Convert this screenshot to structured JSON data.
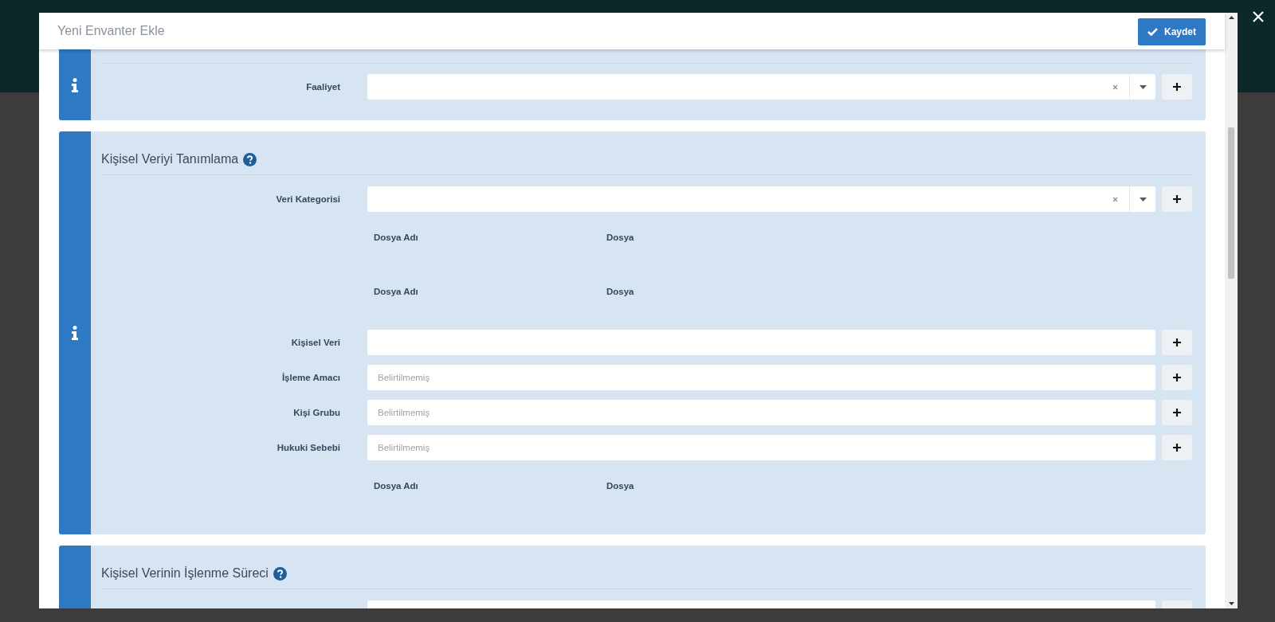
{
  "modal": {
    "title": "Yeni Envanter Ekle",
    "save_button": "Kaydet"
  },
  "sections": [
    {
      "rows": [
        {
          "kind": "select",
          "label": "Faaliyet"
        }
      ]
    },
    {
      "title": "Kişisel Veriyi Tanımlama",
      "rows": [
        {
          "kind": "select",
          "label": "Veri Kategorisi"
        },
        {
          "kind": "files",
          "columns": [
            "Dosya Adı",
            "Dosya"
          ]
        },
        {
          "kind": "files",
          "columns": [
            "Dosya Adı",
            "Dosya"
          ]
        },
        {
          "kind": "text",
          "label": "Kişisel Veri"
        },
        {
          "kind": "text",
          "label": "İşleme Amacı",
          "placeholder": "Belirtilmemiş"
        },
        {
          "kind": "text",
          "label": "Kişi Grubu",
          "placeholder": "Belirtilmemiş"
        },
        {
          "kind": "text",
          "label": "Hukuki Sebebi",
          "placeholder": "Belirtilmemiş"
        },
        {
          "kind": "files",
          "columns": [
            "Dosya Adı",
            "Dosya"
          ]
        }
      ]
    },
    {
      "title": "Kişisel Verinin İşlenme Süreci",
      "rows": [
        {
          "kind": "text"
        }
      ]
    }
  ]
}
